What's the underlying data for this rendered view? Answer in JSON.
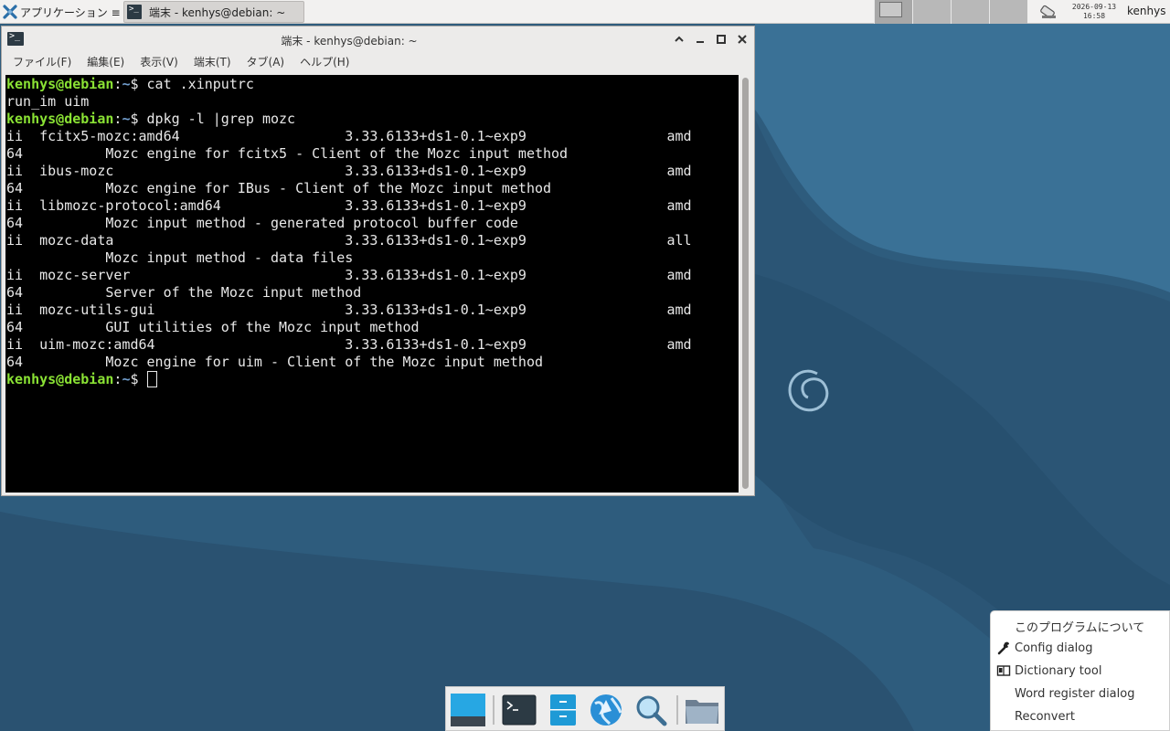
{
  "top_panel": {
    "apps_menu_label": "アプリケーション ≡",
    "task_label": "端末 - kenhys@debian: ~",
    "clock_date": "2026-09-13",
    "clock_time": "16:58",
    "username": "kenhys"
  },
  "terminal": {
    "title": "端末 - kenhys@debian: ~",
    "menu": [
      "ファイル(F)",
      "編集(E)",
      "表示(V)",
      "端末(T)",
      "タブ(A)",
      "ヘルプ(H)"
    ],
    "prompt_user": "kenhys@debian",
    "prompt_path": "~",
    "lines": [
      {
        "kind": "prompt",
        "cmd": " cat .xinputrc"
      },
      {
        "kind": "out",
        "text": "run_im uim"
      },
      {
        "kind": "prompt",
        "cmd": " dpkg -l |grep mozc"
      },
      {
        "kind": "out",
        "text": "ii  fcitx5-mozc:amd64                    3.33.6133+ds1-0.1~exp9                 amd"
      },
      {
        "kind": "out",
        "text": "64          Mozc engine for fcitx5 - Client of the Mozc input method"
      },
      {
        "kind": "out",
        "text": "ii  ibus-mozc                            3.33.6133+ds1-0.1~exp9                 amd"
      },
      {
        "kind": "out",
        "text": "64          Mozc engine for IBus - Client of the Mozc input method"
      },
      {
        "kind": "out",
        "text": "ii  libmozc-protocol:amd64               3.33.6133+ds1-0.1~exp9                 amd"
      },
      {
        "kind": "out",
        "text": "64          Mozc input method - generated protocol buffer code"
      },
      {
        "kind": "out",
        "text": "ii  mozc-data                            3.33.6133+ds1-0.1~exp9                 all"
      },
      {
        "kind": "out",
        "text": "            Mozc input method - data files"
      },
      {
        "kind": "out",
        "text": "ii  mozc-server                          3.33.6133+ds1-0.1~exp9                 amd"
      },
      {
        "kind": "out",
        "text": "64          Server of the Mozc input method"
      },
      {
        "kind": "out",
        "text": "ii  mozc-utils-gui                       3.33.6133+ds1-0.1~exp9                 amd"
      },
      {
        "kind": "out",
        "text": "64          GUI utilities of the Mozc input method"
      },
      {
        "kind": "out",
        "text": "ii  uim-mozc:amd64                       3.33.6133+ds1-0.1~exp9                 amd"
      },
      {
        "kind": "out",
        "text": "64          Mozc engine for uim - Client of the Mozc input method"
      },
      {
        "kind": "cursor",
        "cmd": " "
      }
    ]
  },
  "dock": {
    "items": [
      "show-desktop-icon",
      "terminal-icon",
      "file-manager-icon",
      "web-browser-icon",
      "app-finder-icon",
      "folder-icon"
    ]
  },
  "context_menu": {
    "items": [
      {
        "label": "このプログラムについて",
        "icon": ""
      },
      {
        "label": "Config dialog",
        "icon": "wrench-icon"
      },
      {
        "label": "Dictionary tool",
        "icon": "dictionary-icon"
      },
      {
        "label": "Word register dialog",
        "icon": ""
      },
      {
        "label": "Reconvert",
        "icon": ""
      }
    ]
  },
  "colors": {
    "desktop_bg": "#2d5878",
    "prompt_green": "#8ae234",
    "path_blue": "#729fcf"
  }
}
